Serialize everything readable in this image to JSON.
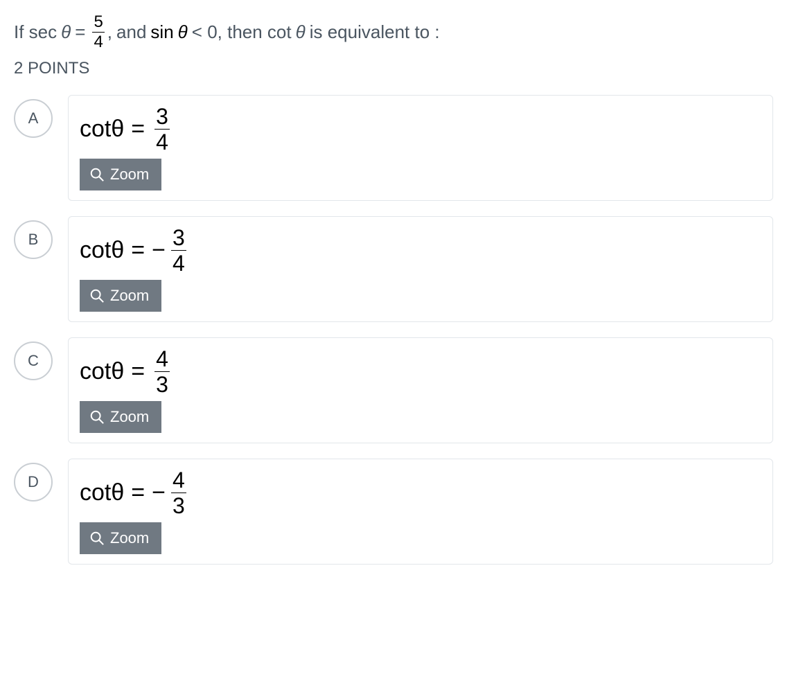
{
  "question": {
    "prefix": "If  sec",
    "theta": "θ",
    "equals": " = ",
    "frac_num": "5",
    "frac_den": "4",
    "comma": ",",
    "mid1": " and ",
    "sin": "sin",
    "theta2": " θ ",
    "lt": "< 0, then cot",
    "theta3": "θ",
    "suffix": "  is equivalent to :"
  },
  "points_label": "2 POINTS",
  "zoom_label": "Zoom",
  "formula_lhs": "cotθ",
  "formula_eq": "=",
  "options": [
    {
      "letter": "A",
      "negative": false,
      "num": "3",
      "den": "4"
    },
    {
      "letter": "B",
      "negative": true,
      "num": "3",
      "den": "4"
    },
    {
      "letter": "C",
      "negative": false,
      "num": "4",
      "den": "3"
    },
    {
      "letter": "D",
      "negative": true,
      "num": "4",
      "den": "3"
    }
  ]
}
